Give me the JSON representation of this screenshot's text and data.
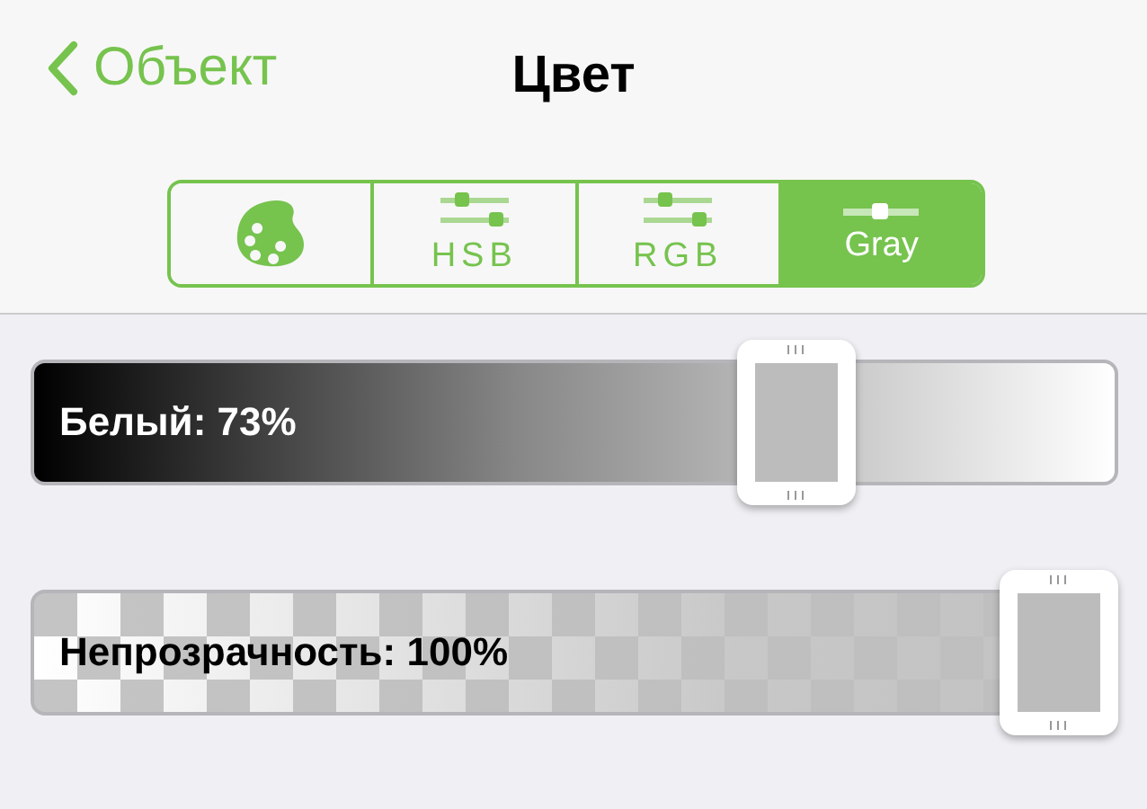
{
  "nav": {
    "back": "Объект",
    "title": "Цвет"
  },
  "segments": [
    {
      "kind": "palette",
      "selected": false
    },
    {
      "kind": "double",
      "label": "HSB",
      "selected": false
    },
    {
      "kind": "double",
      "label": "RGB",
      "selected": false
    },
    {
      "kind": "single",
      "label": "Gray",
      "selected": true
    }
  ],
  "sliders": [
    {
      "kind": "gray",
      "label": "Белый: 73%",
      "level": 0.73
    },
    {
      "kind": "opacity",
      "label": "Непрозрачность: 100%",
      "level": 1
    }
  ]
}
